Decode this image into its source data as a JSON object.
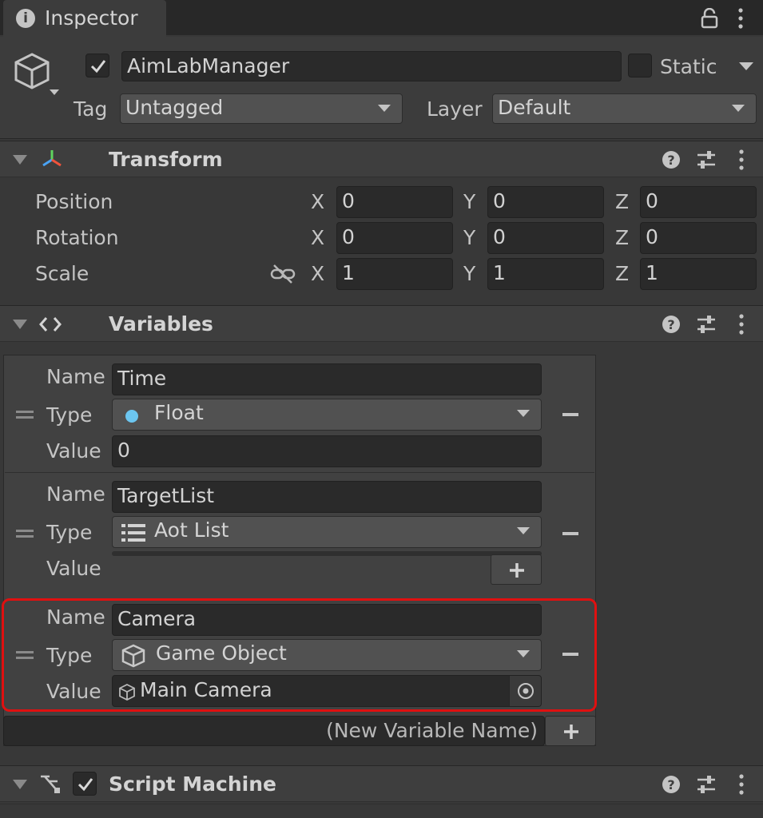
{
  "window": {
    "tab_title": "Inspector"
  },
  "object": {
    "name": "AimLabManager",
    "active": true,
    "static_label": "Static",
    "tag_label": "Tag",
    "tag_value": "Untagged",
    "layer_label": "Layer",
    "layer_value": "Default"
  },
  "transform": {
    "title": "Transform",
    "rows": [
      {
        "label": "Position",
        "x": "0",
        "y": "0",
        "z": "0"
      },
      {
        "label": "Rotation",
        "x": "0",
        "y": "0",
        "z": "0"
      },
      {
        "label": "Scale",
        "x": "1",
        "y": "1",
        "z": "1"
      }
    ],
    "axis": {
      "x": "X",
      "y": "Y",
      "z": "Z"
    }
  },
  "variables": {
    "title": "Variables",
    "labels": {
      "name": "Name",
      "type": "Type",
      "value": "Value"
    },
    "items": [
      {
        "name": "Time",
        "type": "Float",
        "type_icon": "float-dot-icon",
        "value": "0"
      },
      {
        "name": "TargetList",
        "type": "Aot List",
        "type_icon": "list-icon",
        "value": ""
      },
      {
        "name": "Camera",
        "type": "Game Object",
        "type_icon": "gameobject-icon",
        "value": "Main Camera"
      }
    ],
    "new_variable_placeholder": "(New Variable Name)"
  },
  "script_machine": {
    "title": "Script Machine",
    "enabled": true
  },
  "colors": {
    "highlight": "#e01010",
    "float_dot": "#6cc6f0",
    "bg": "#383838"
  }
}
